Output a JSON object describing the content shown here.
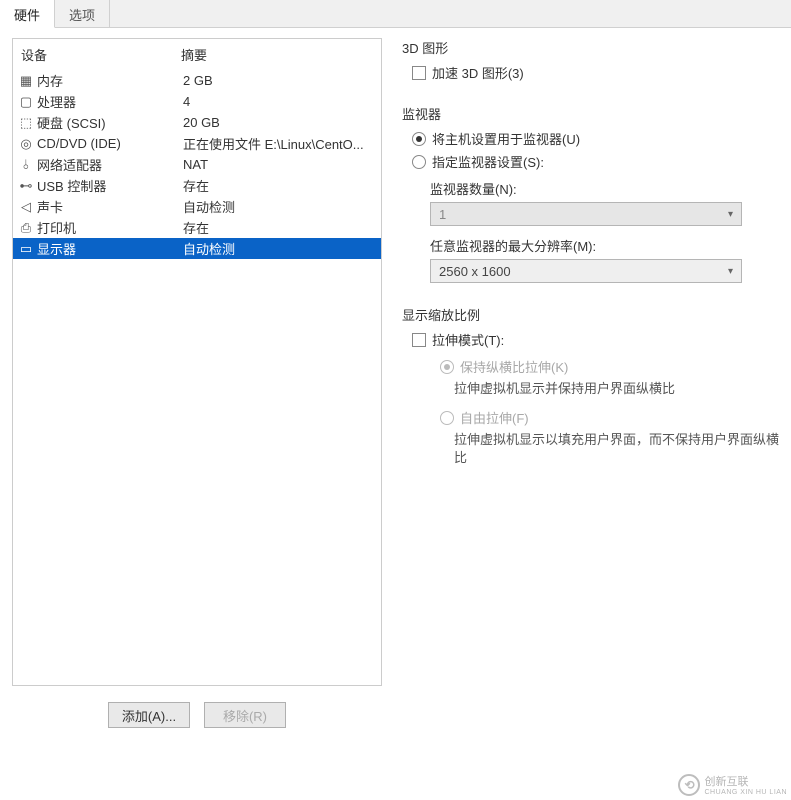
{
  "tabs": {
    "hardware": "硬件",
    "options": "选项"
  },
  "hw_header": {
    "device": "设备",
    "summary": "摘要"
  },
  "hw": [
    {
      "icon": "memory-icon",
      "glyph": "▦",
      "label": "内存",
      "summary": "2 GB"
    },
    {
      "icon": "cpu-icon",
      "glyph": "▢",
      "label": "处理器",
      "summary": "4"
    },
    {
      "icon": "disk-icon",
      "glyph": "⬚",
      "label": "硬盘 (SCSI)",
      "summary": "20 GB"
    },
    {
      "icon": "cd-icon",
      "glyph": "◎",
      "label": "CD/DVD (IDE)",
      "summary": "正在使用文件 E:\\Linux\\CentO..."
    },
    {
      "icon": "network-icon",
      "glyph": "⫰",
      "label": "网络适配器",
      "summary": "NAT"
    },
    {
      "icon": "usb-icon",
      "glyph": "⊷",
      "label": "USB 控制器",
      "summary": "存在"
    },
    {
      "icon": "sound-icon",
      "glyph": "◁",
      "label": "声卡",
      "summary": "自动检测"
    },
    {
      "icon": "printer-icon",
      "glyph": "⎙",
      "label": "打印机",
      "summary": "存在"
    },
    {
      "icon": "display-icon",
      "glyph": "▭",
      "label": "显示器",
      "summary": "自动检测"
    }
  ],
  "right": {
    "graphics_title": "3D 图形",
    "accel_3d": "加速 3D 图形(3)",
    "monitors_title": "监视器",
    "use_host_monitor": "将主机设置用于监视器(U)",
    "specify_monitor": "指定监视器设置(S):",
    "monitor_count_label": "监视器数量(N):",
    "monitor_count_value": "1",
    "max_res_label": "任意监视器的最大分辨率(M):",
    "max_res_value": "2560 x 1600",
    "scaling_title": "显示缩放比例",
    "stretch_mode": "拉伸模式(T):",
    "keep_aspect": "保持纵横比拉伸(K)",
    "keep_aspect_desc": "拉伸虚拟机显示并保持用户界面纵横比",
    "free_stretch": "自由拉伸(F)",
    "free_stretch_desc": "拉伸虚拟机显示以填充用户界面，而不保持用户界面纵横比"
  },
  "buttons": {
    "add": "添加(A)...",
    "remove": "移除(R)"
  },
  "watermark": {
    "brand": "创新互联",
    "sub": "CHUANG XIN HU LIAN"
  }
}
